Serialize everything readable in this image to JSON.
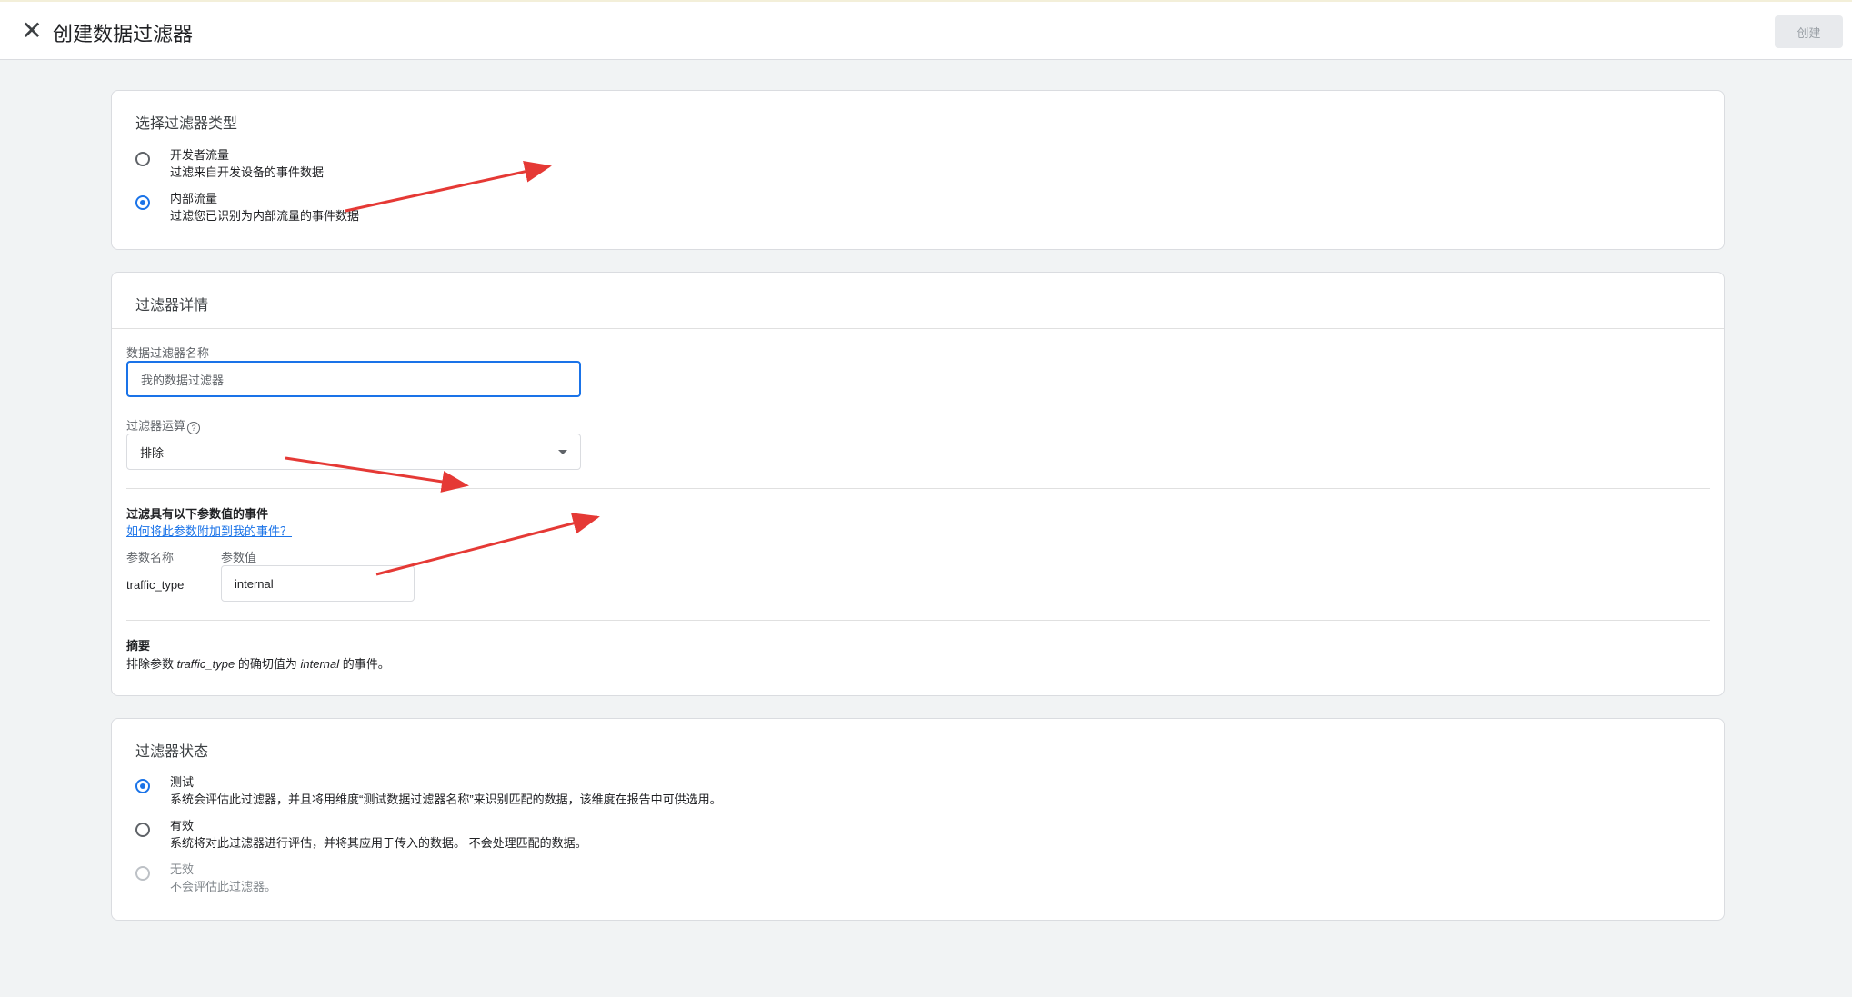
{
  "header": {
    "title": "创建数据过滤器",
    "create_label": "创建",
    "close_icon": "close-icon"
  },
  "filter_type": {
    "title": "选择过滤器类型",
    "options": [
      {
        "label": "开发者流量",
        "desc": "过滤来自开发设备的事件数据",
        "selected": false
      },
      {
        "label": "内部流量",
        "desc": "过滤您已识别为内部流量的事件数据",
        "selected": true
      }
    ]
  },
  "details": {
    "title": "过滤器详情",
    "name_label": "数据过滤器名称",
    "name_placeholder": "我的数据过滤器",
    "operation_label": "过滤器运算",
    "operation_value": "排除",
    "events_title": "过滤具有以下参数值的事件",
    "help_link": "如何将此参数附加到我的事件？",
    "param_name_header": "参数名称",
    "param_value_header": "参数值",
    "param_name": "traffic_type",
    "param_value": "internal",
    "summary_title": "摘要",
    "summary_prefix": "排除参数",
    "summary_param": "traffic_type",
    "summary_mid": "的确切值为",
    "summary_value": "internal",
    "summary_suffix": "的事件。"
  },
  "status": {
    "title": "过滤器状态",
    "options": [
      {
        "label": "测试",
        "desc": "系统会评估此过滤器，并且将用维度“测试数据过滤器名称”来识别匹配的数据，该维度在报告中可供选用。",
        "selected": true,
        "disabled": false
      },
      {
        "label": "有效",
        "desc": "系统将对此过滤器进行评估，并将其应用于传入的数据。 不会处理匹配的数据。",
        "selected": false,
        "disabled": false
      },
      {
        "label": "无效",
        "desc": "不会评估此过滤器。",
        "selected": false,
        "disabled": true
      }
    ]
  },
  "colors": {
    "accent": "#1a73e8",
    "annotation_arrow": "#e53935"
  }
}
